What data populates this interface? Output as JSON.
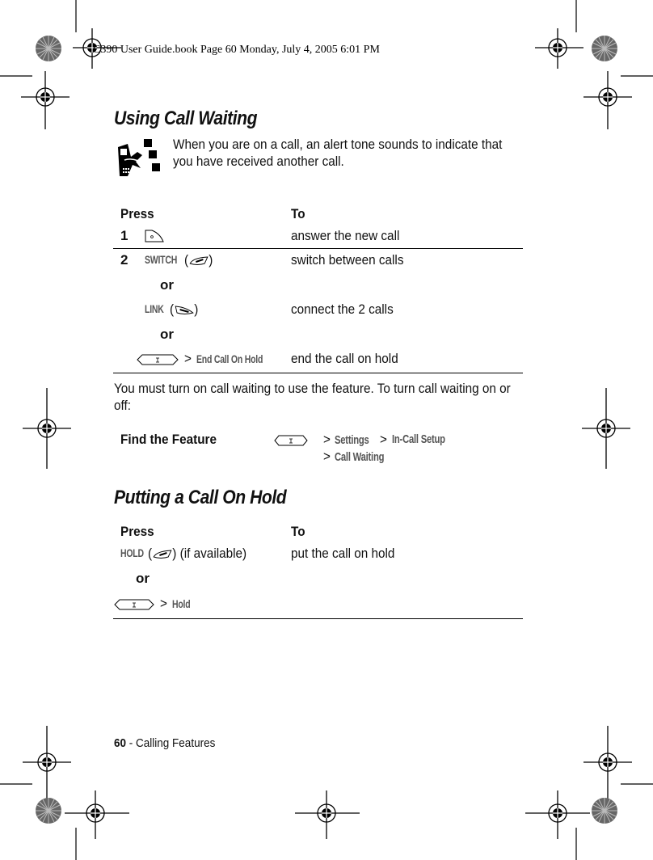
{
  "header_note": "C390 User Guide.book  Page 60  Monday, July 4, 2005  6:01 PM",
  "section1": {
    "title": "Using Call Waiting",
    "intro": "When you are on a call, an alert tone sounds to indicate that you have received another call.",
    "icon": "network-feature-icon",
    "table": {
      "col_press": "Press",
      "col_to": "To",
      "rows": [
        {
          "num": "1",
          "key": "send-key-icon",
          "to": "answer the new call"
        },
        {
          "num": "2",
          "softkey": "SWITCH",
          "key": "right-soft-key-icon",
          "to": "switch between calls"
        },
        {
          "or": "or"
        },
        {
          "softkey": "LINK",
          "key": "left-soft-key-icon",
          "to": "connect the 2 calls"
        },
        {
          "or": "or"
        },
        {
          "key": "menu-key-icon",
          "sep": ">",
          "menu_item": "End Call On Hold",
          "to": "end the call on hold"
        }
      ]
    },
    "after_text": "You must turn on call waiting to use the feature. To turn call waiting on or off:",
    "find_feature": {
      "label": "Find the Feature",
      "key": "menu-key-icon",
      "path": [
        ">",
        "Settings",
        ">",
        "In-Call Setup",
        ">",
        "Call Waiting"
      ]
    }
  },
  "section2": {
    "title": "Putting a Call On Hold",
    "table": {
      "col_press": "Press",
      "col_to": "To",
      "row1": {
        "softkey": "HOLD",
        "key": "right-soft-key-icon",
        "suffix": "(if available)",
        "to": "put the call on hold"
      },
      "or": "or",
      "row2": {
        "key": "menu-key-icon",
        "sep": ">",
        "menu_item": "Hold"
      }
    }
  },
  "footer": {
    "page_num": "60",
    "dash": " - ",
    "section": "Calling Features"
  }
}
